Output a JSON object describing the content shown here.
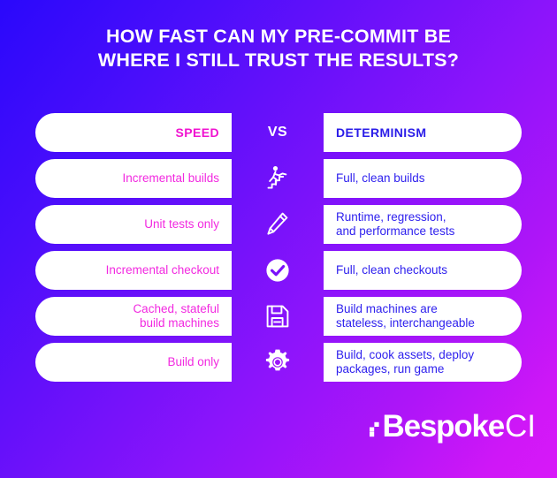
{
  "title": {
    "line1": "HOW FAST CAN MY PRE-COMMIT BE",
    "line2": "WHERE I STILL TRUST THE RESULTS?"
  },
  "colors": {
    "background_start": "#2a08fb",
    "background_end": "#d818f8",
    "speed_pink": "#f013d0",
    "row_pink": "#f229e0",
    "determinism_blue": "#2a1ce8",
    "row_blue": "#2f21ee",
    "pill_background": "#ffffff",
    "white": "#ffffff"
  },
  "header_row": {
    "left_label": "SPEED",
    "center_label": "VS",
    "right_label": "DETERMINISM"
  },
  "comparison_rows": [
    {
      "icon": "stairs-climber-icon",
      "left": "Incremental builds",
      "right": "Full, clean builds"
    },
    {
      "icon": "pencil-icon",
      "left": "Unit tests only",
      "right": "Runtime, regression,\nand performance tests"
    },
    {
      "icon": "check-circle-icon",
      "left": "Incremental checkout",
      "right": "Full, clean checkouts"
    },
    {
      "icon": "floppy-disk-icon",
      "left": "Cached, stateful\nbuild machines",
      "right": "Build machines are\nstateless, interchangeable"
    },
    {
      "icon": "gear-icon",
      "left": "Build only",
      "right": "Build, cook assets, deploy\npackages, run game"
    }
  ],
  "logo": {
    "primary": "Bespoke",
    "secondary": "CI"
  }
}
